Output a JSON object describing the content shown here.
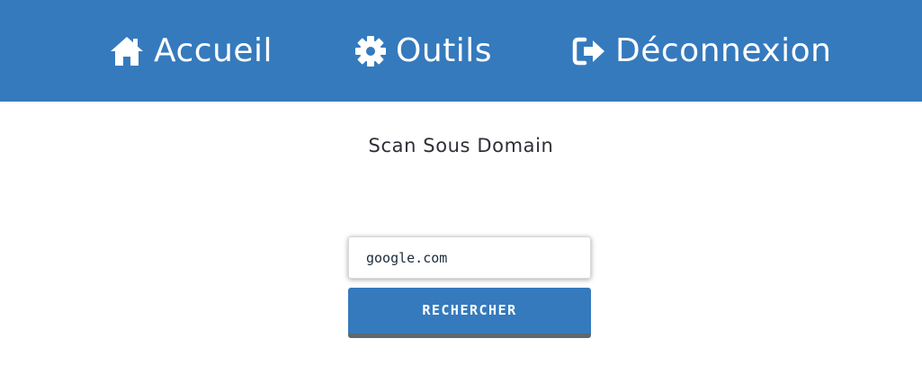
{
  "nav": {
    "background": "#357ABD",
    "items": [
      {
        "label": "Accueil",
        "icon": "home-icon"
      },
      {
        "label": "Outils",
        "icon": "gear-icon"
      },
      {
        "label": "Déconnexion",
        "icon": "sign-out-icon"
      }
    ]
  },
  "main": {
    "title": "Scan Sous Domain",
    "search": {
      "value": "google.com",
      "placeholder": ""
    },
    "button_label": "RECHERCHER",
    "accent": "#357ABD"
  }
}
